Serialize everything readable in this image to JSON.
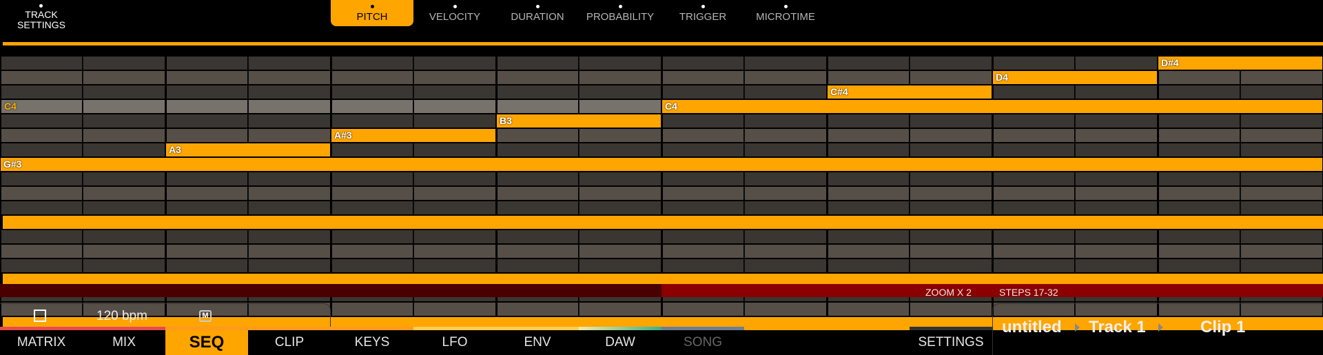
{
  "track_settings": {
    "line1": "TRACK",
    "line2": "SETTINGS"
  },
  "param_tabs": [
    {
      "label": "PITCH",
      "active": true
    },
    {
      "label": "VELOCITY",
      "active": false
    },
    {
      "label": "DURATION",
      "active": false
    },
    {
      "label": "PROBABILITY",
      "active": false
    },
    {
      "label": "TRIGGER",
      "active": false
    },
    {
      "label": "MICROTIME",
      "active": false
    }
  ],
  "notes": [
    {
      "label": "D#4",
      "step": 14,
      "length": 2,
      "row": 0
    },
    {
      "label": "D4",
      "step": 12,
      "length": 2,
      "row": 1
    },
    {
      "label": "C#4",
      "step": 10,
      "length": 2,
      "row": 2
    },
    {
      "label": "C4",
      "step": 8,
      "length": 8,
      "row": 3
    },
    {
      "label": "B3",
      "step": 6,
      "length": 2,
      "row": 4
    },
    {
      "label": "A#3",
      "step": 4,
      "length": 2,
      "row": 5
    },
    {
      "label": "A3",
      "step": 2,
      "length": 2,
      "row": 6
    },
    {
      "label": "G#3",
      "step": 0,
      "length": 16,
      "row": 7
    }
  ],
  "row_labels": {
    "c4": "C4"
  },
  "status": {
    "zoom": "ZOOM X 2",
    "steps": "STEPS 17-32"
  },
  "transport": {
    "bpm": "120 bpm",
    "metronome": "M"
  },
  "nav_tabs": [
    {
      "label": "MATRIX"
    },
    {
      "label": "MIX"
    },
    {
      "label": "SEQ"
    },
    {
      "label": "CLIP"
    },
    {
      "label": "KEYS"
    },
    {
      "label": "LFO"
    },
    {
      "label": "ENV"
    },
    {
      "label": "DAW"
    },
    {
      "label": "SONG"
    }
  ],
  "settings_label": "SETTINGS",
  "breadcrumb": {
    "project": "untitled",
    "track": "Track 1",
    "clip": "Clip 1"
  },
  "colors": {
    "accent": "#ffa500",
    "status_red": "#8b0000"
  }
}
